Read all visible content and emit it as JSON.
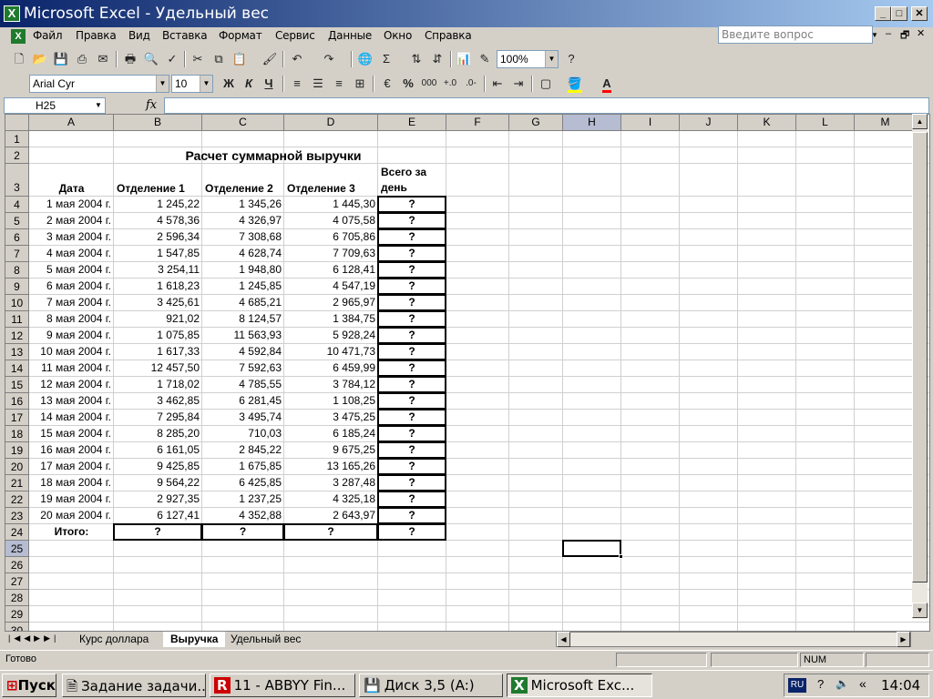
{
  "window": {
    "title": "Microsoft Excel - Удельный вес"
  },
  "menu": [
    "Файл",
    "Правка",
    "Вид",
    "Вставка",
    "Формат",
    "Сервис",
    "Данные",
    "Окно",
    "Справка"
  ],
  "help_placeholder": "Введите вопрос",
  "toolbar": {
    "zoom": "100%",
    "font_name": "Arial Cyr",
    "font_size": "10",
    "sigma": "Σ",
    "bold": "Ж",
    "italic": "К",
    "underline": "Ч",
    "percent": "%",
    "thousands": "000"
  },
  "formula_bar": {
    "name_box": "H25",
    "fx": "fx",
    "formula": ""
  },
  "columns": [
    "A",
    "B",
    "C",
    "D",
    "E",
    "F",
    "G",
    "H",
    "I",
    "J",
    "K",
    "L",
    "M"
  ],
  "selected_column": "H",
  "selected_row": 25,
  "sheet": {
    "title": "Расчет суммарной выручки",
    "headers": {
      "date": "Дата",
      "dept1": "Отделение 1",
      "dept2": "Отделение 2",
      "dept3": "Отделение 3",
      "total_line1": "Всего за",
      "total_line2": "день"
    },
    "rows": [
      {
        "date": "1 мая 2004 г.",
        "d1": "1 245,22",
        "d2": "1 345,26",
        "d3": "1 445,30",
        "total": "?"
      },
      {
        "date": "2 мая 2004 г.",
        "d1": "4 578,36",
        "d2": "4 326,97",
        "d3": "4 075,58",
        "total": "?"
      },
      {
        "date": "3 мая 2004 г.",
        "d1": "2 596,34",
        "d2": "7 308,68",
        "d3": "6 705,86",
        "total": "?"
      },
      {
        "date": "4 мая 2004 г.",
        "d1": "1 547,85",
        "d2": "4 628,74",
        "d3": "7 709,63",
        "total": "?"
      },
      {
        "date": "5 мая 2004 г.",
        "d1": "3 254,11",
        "d2": "1 948,80",
        "d3": "6 128,41",
        "total": "?"
      },
      {
        "date": "6 мая 2004 г.",
        "d1": "1 618,23",
        "d2": "1 245,85",
        "d3": "4 547,19",
        "total": "?"
      },
      {
        "date": "7 мая 2004 г.",
        "d1": "3 425,61",
        "d2": "4 685,21",
        "d3": "2 965,97",
        "total": "?"
      },
      {
        "date": "8 мая 2004 г.",
        "d1": "921,02",
        "d2": "8 124,57",
        "d3": "1 384,75",
        "total": "?"
      },
      {
        "date": "9 мая 2004 г.",
        "d1": "1 075,85",
        "d2": "11 563,93",
        "d3": "5 928,24",
        "total": "?"
      },
      {
        "date": "10 мая 2004 г.",
        "d1": "1 617,33",
        "d2": "4 592,84",
        "d3": "10 471,73",
        "total": "?"
      },
      {
        "date": "11 мая 2004 г.",
        "d1": "12 457,50",
        "d2": "7 592,63",
        "d3": "6 459,99",
        "total": "?"
      },
      {
        "date": "12 мая 2004 г.",
        "d1": "1 718,02",
        "d2": "4 785,55",
        "d3": "3 784,12",
        "total": "?"
      },
      {
        "date": "13 мая 2004 г.",
        "d1": "3 462,85",
        "d2": "6 281,45",
        "d3": "1 108,25",
        "total": "?"
      },
      {
        "date": "14 мая 2004 г.",
        "d1": "7 295,84",
        "d2": "3 495,74",
        "d3": "3 475,25",
        "total": "?"
      },
      {
        "date": "15 мая 2004 г.",
        "d1": "8 285,20",
        "d2": "710,03",
        "d3": "6 185,24",
        "total": "?"
      },
      {
        "date": "16 мая 2004 г.",
        "d1": "6 161,05",
        "d2": "2 845,22",
        "d3": "9 675,25",
        "total": "?"
      },
      {
        "date": "17 мая 2004 г.",
        "d1": "9 425,85",
        "d2": "1 675,85",
        "d3": "13 165,26",
        "total": "?"
      },
      {
        "date": "18 мая 2004 г.",
        "d1": "9 564,22",
        "d2": "6 425,85",
        "d3": "3 287,48",
        "total": "?"
      },
      {
        "date": "19 мая 2004 г.",
        "d1": "2 927,35",
        "d2": "1 237,25",
        "d3": "4 325,18",
        "total": "?"
      },
      {
        "date": "20 мая 2004 г.",
        "d1": "6 127,41",
        "d2": "4 352,88",
        "d3": "2 643,97",
        "total": "?"
      }
    ],
    "totals": {
      "label": "Итого:",
      "d1": "?",
      "d2": "?",
      "d3": "?",
      "total": "?"
    }
  },
  "sheet_tabs": [
    {
      "label": "Курс доллара",
      "active": false
    },
    {
      "label": "Выручка",
      "active": true
    },
    {
      "label": "Удельный вес",
      "active": false
    }
  ],
  "status": {
    "left": "Готово",
    "num": "NUM"
  },
  "taskbar": {
    "start": "Пуск",
    "buttons": [
      "Задание задачи...",
      "11 - ABBYY Fin...",
      "Диск 3,5 (A:)",
      "Microsoft Exc..."
    ],
    "active_index": 3,
    "lang": "RU",
    "clock": "14:04"
  }
}
